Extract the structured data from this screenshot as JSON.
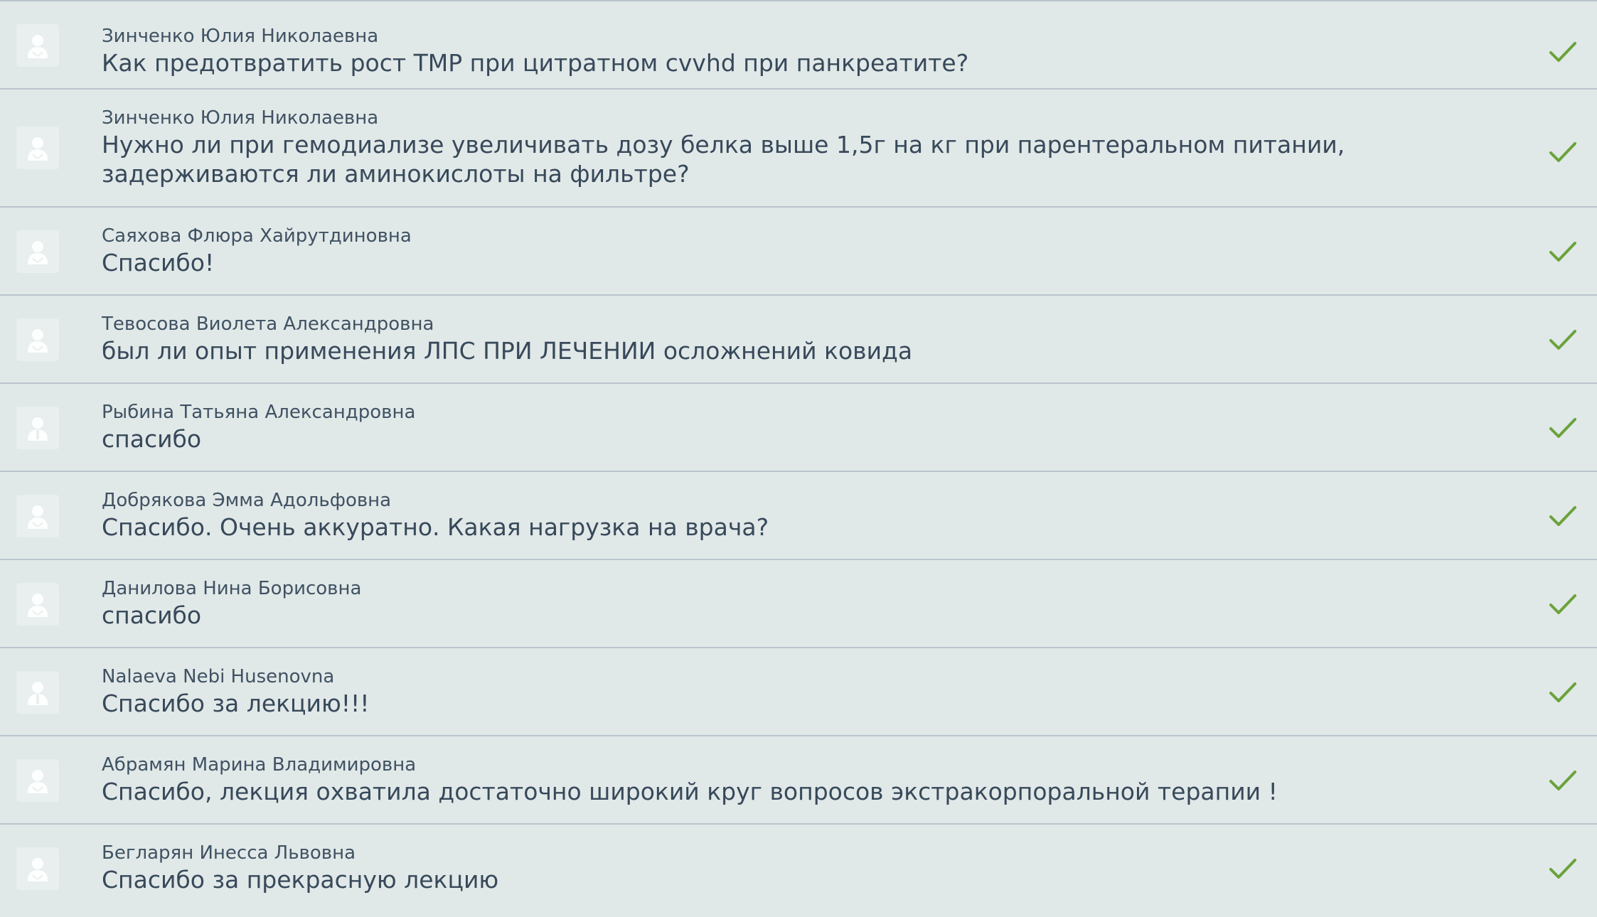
{
  "messages": [
    {
      "author": "Зинченко Юлия Николаевна",
      "text": "Как предотвратить рост ТМР при цитратном cvvhd при панкреатите?"
    },
    {
      "author": "Зинченко Юлия Николаевна",
      "text": "Нужно ли при гемодиализе увеличивать дозу белка выше 1,5г на кг при парентеральном питании, задерживаются ли аминокислоты на фильтре?"
    },
    {
      "author": "Саяхова Флюра Хайрутдиновна",
      "text": "Спасибо!"
    },
    {
      "author": "Тевосова Виолета Александровна",
      "text": "был ли опыт применения ЛПС ПРИ ЛЕЧЕНИИ осложнений ковида"
    },
    {
      "author": "Рыбина Татьяна Александровна",
      "text": "спасибо"
    },
    {
      "author": "Добрякова Эмма Адольфовна",
      "text": "Спасибо. Очень аккуратно. Какая нагрузка на врача?"
    },
    {
      "author": "Данилова Нина Борисовна",
      "text": "спасибо"
    },
    {
      "author": "Nalaeva Nebi Husenovna",
      "text": "Спасибо за лекцию!!!"
    },
    {
      "author": "Абрамян Марина Владимировна",
      "text": "Спасибо, лекция охватила достаточно широкий круг вопросов экстракорпоральной терапии !"
    },
    {
      "author": "Бегларян Инесса Львовна",
      "text": "Спасибо за прекрасную лекцию"
    }
  ],
  "icons": {
    "avatar": "user-placeholder-icon",
    "status": "checkmark-icon"
  },
  "colors": {
    "background": "#e1e8e8",
    "divider": "#b9c5cd",
    "text": "#37495a",
    "check": "#6aa33a"
  }
}
